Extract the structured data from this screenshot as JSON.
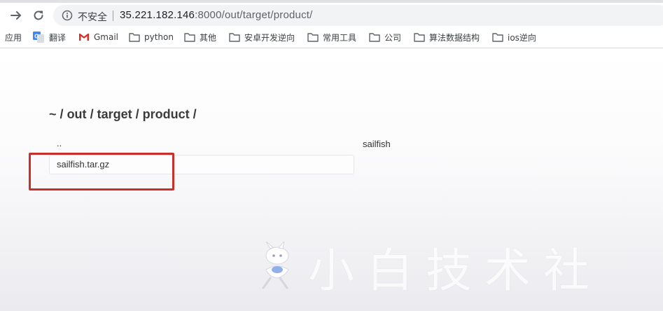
{
  "browser": {
    "security_label": "不安全",
    "url_host": "35.221.182.146",
    "url_rest": ":8000/out/target/product/",
    "icons": [
      "forward-icon",
      "reload-icon",
      "info-icon"
    ]
  },
  "bookmarks": [
    {
      "label": "应用",
      "icon": "apps-grid-icon"
    },
    {
      "label": "翻译",
      "icon": "google-translate-icon"
    },
    {
      "label": "Gmail",
      "icon": "gmail-icon"
    },
    {
      "label": "python",
      "icon": "folder-icon"
    },
    {
      "label": "其他",
      "icon": "folder-icon"
    },
    {
      "label": "安卓开发逆向",
      "icon": "folder-icon"
    },
    {
      "label": "常用工具",
      "icon": "folder-icon"
    },
    {
      "label": "公司",
      "icon": "folder-icon"
    },
    {
      "label": "算法数据结构",
      "icon": "folder-icon"
    },
    {
      "label": "ios逆向",
      "icon": "folder-icon"
    }
  ],
  "listing": {
    "breadcrumb": [
      "~",
      "/",
      "out",
      "/",
      "target",
      "/",
      "product",
      "/"
    ],
    "parent_link": "..",
    "side_label": "sailfish",
    "files": [
      {
        "name": "sailfish.tar.gz"
      }
    ],
    "highlight_color": "#c9302c"
  },
  "watermark": {
    "text": "小白技术社",
    "icon": "rabbit-mascot-icon"
  }
}
